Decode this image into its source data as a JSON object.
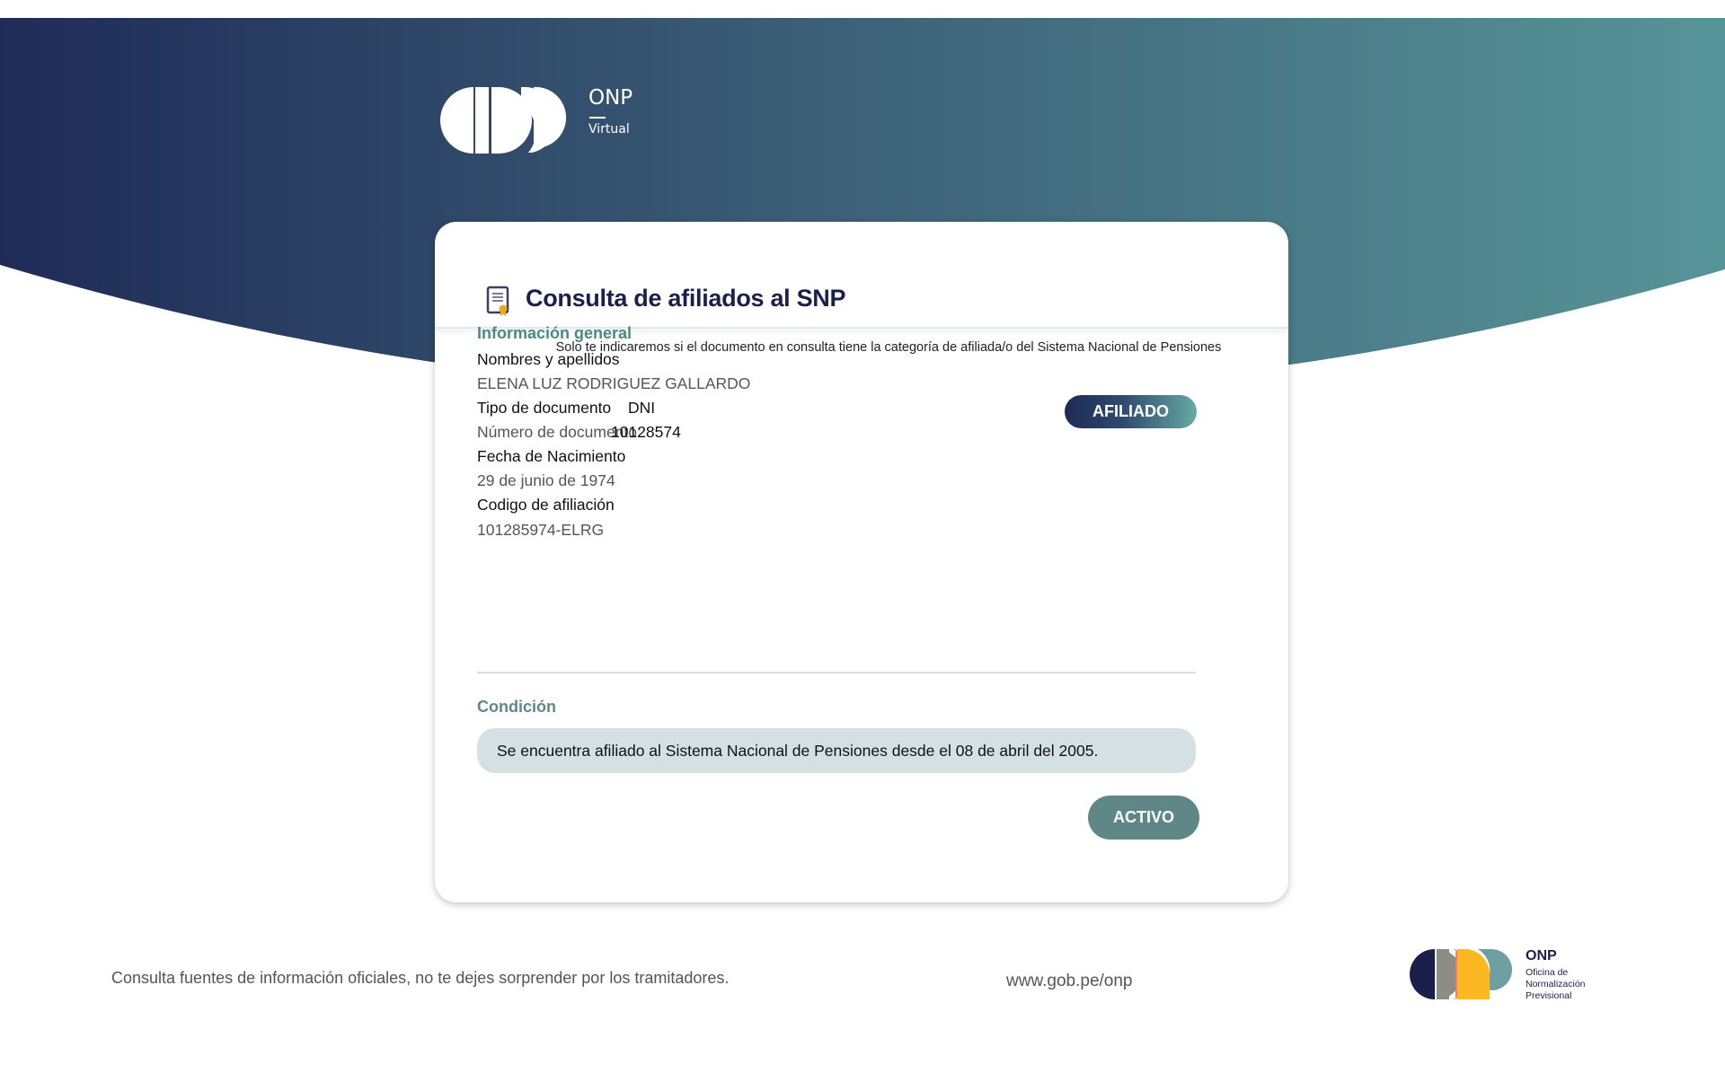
{
  "header": {
    "logo": {
      "brand": "ONP",
      "sub": "Virtual"
    }
  },
  "card": {
    "title": "Consulta de afiliados al SNP",
    "icon": "certificate-document-icon",
    "subtitle": "Solo te indicaremos si el documento en consulta tiene la categoría de afiliada/o del Sistema Nacional de Pensiones",
    "general": {
      "heading": "Información general",
      "status_badge": "AFILIADO",
      "name_label": "Nombres y apellidos",
      "name_value": "ELENA LUZ RODRIGUEZ GALLARDO",
      "doc_type_label": "Tipo de documento",
      "doc_type_value": "DNI",
      "doc_number_label": "Número de documento:",
      "doc_number_value": "10128574",
      "birth_label": "Fecha de Nacimiento",
      "birth_value": "29 de junio de 1974",
      "code_label": "Codigo de afiliación",
      "code_value": "101285974-ELRG"
    },
    "condition": {
      "heading": "Condición",
      "text": "Se encuentra afiliado al Sistema Nacional de Pensiones desde el 08 de abril del 2005.",
      "status_button": "ACTIVO"
    }
  },
  "footer": {
    "notice": "Consulta fuentes de información oficiales, no te dejes sorprender por los tramitadores.",
    "url": "www.gob.pe/onp",
    "logo": {
      "brand": "ONP",
      "line1": "Oficina de",
      "line2": "Normalización",
      "line3": "Previsional"
    }
  },
  "colors": {
    "navy": "#1d2954",
    "teal": "#5a9a9a",
    "accent_green": "#4a8a80",
    "activo": "#5f8786"
  }
}
